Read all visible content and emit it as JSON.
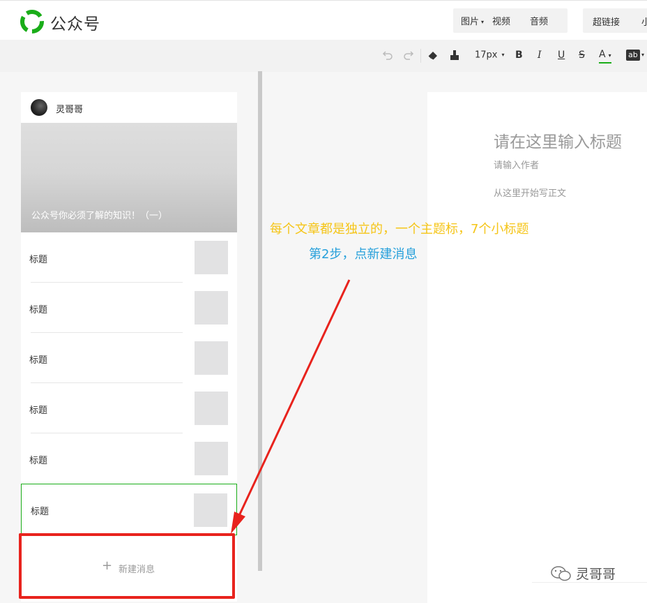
{
  "header": {
    "brand": "公众号",
    "media_buttons": [
      "图片",
      "视频",
      "音频"
    ],
    "link_buttons": [
      "超链接",
      "小"
    ]
  },
  "toolbar": {
    "font_size": "17px",
    "icons": [
      "undo-icon",
      "redo-icon",
      "eraser-icon",
      "format-brush-icon",
      "chevron-down-icon",
      "bold-icon",
      "italic-icon",
      "underline-icon",
      "strikethrough-icon",
      "font-color-icon",
      "background-color-icon"
    ],
    "bold_label": "B",
    "italic_label": "I",
    "underline_label": "U",
    "strike_label": "S",
    "font_color_label": "A",
    "bg_color_label": "ab",
    "accent_color": "#1aad19"
  },
  "article_list": {
    "account_name": "灵哥哥",
    "cover_title": "公众号你必须了解的知识！（一）",
    "items": [
      {
        "title": "标题"
      },
      {
        "title": "标题"
      },
      {
        "title": "标题"
      },
      {
        "title": "标题"
      },
      {
        "title": "标题"
      },
      {
        "title": "标题",
        "active": true
      }
    ],
    "new_message_label": "新建消息"
  },
  "editor": {
    "title_placeholder": "请在这里输入标题",
    "author_placeholder": "请输入作者",
    "body_placeholder": "从这里开始写正文"
  },
  "annotations": {
    "note1": "每个文章都是独立的，一个主题标，7个小标题",
    "note2": "第2步，点新建消息",
    "note1_color": "#f5c518",
    "note2_color": "#27a0db",
    "highlight_color": "#e8231d"
  },
  "watermark": {
    "text": "灵哥哥"
  }
}
